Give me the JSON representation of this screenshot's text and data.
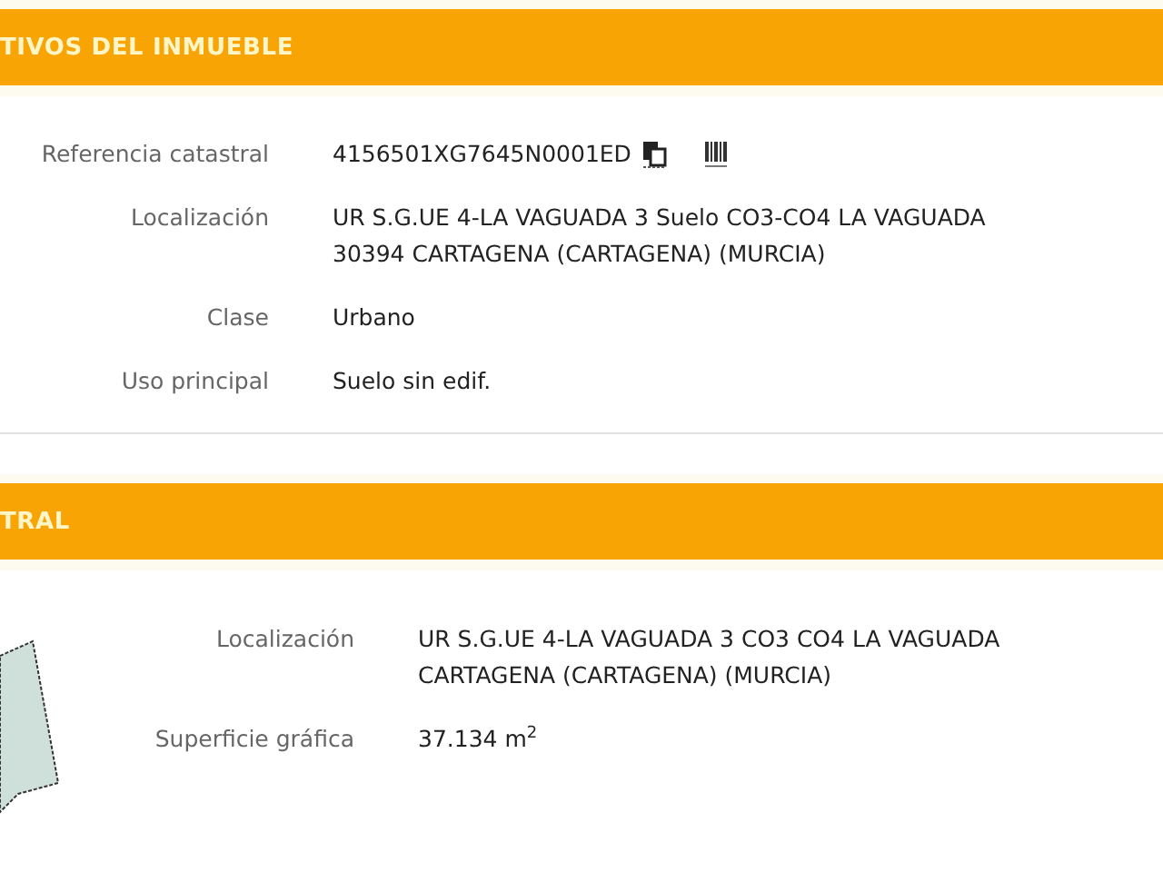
{
  "sections": [
    {
      "title": "TIVOS DEL INMUEBLE",
      "rows": [
        {
          "label": "Referencia catastral",
          "value": "4156501XG7645N0001ED",
          "kind": "reference"
        },
        {
          "label": "Localización",
          "value": "UR S.G.UE 4-LA VAGUADA 3 Suelo CO3-CO4 LA VAGUADA",
          "value_line_2": "30394 CARTAGENA (CARTAGENA) (MURCIA)",
          "kind": "text"
        },
        {
          "label": "Clase",
          "value": "Urbano",
          "kind": "text"
        },
        {
          "label": "Uso principal",
          "value": "Suelo sin edif.",
          "kind": "text"
        }
      ]
    },
    {
      "title": "TRAL",
      "rows": [
        {
          "label": "Localización",
          "value": "UR S.G.UE 4-LA VAGUADA 3 CO3 CO4 LA VAGUADA",
          "value_line_2": "CARTAGENA (CARTAGENA) (MURCIA)",
          "kind": "text"
        },
        {
          "label": "Superficie gráfica",
          "value": "37.134 m$^{2}$",
          "kind": "text"
        }
      ],
      "map": true
    }
  ]
}
